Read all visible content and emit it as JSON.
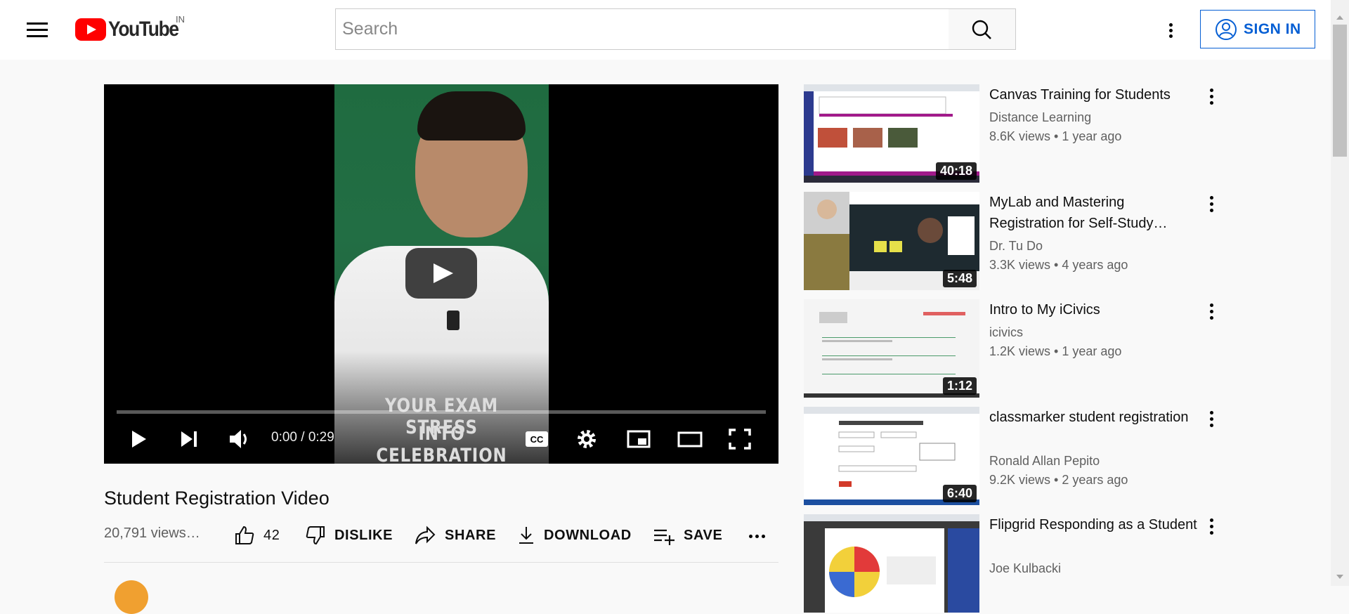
{
  "header": {
    "logo_text": "YouTube",
    "country_code": "IN",
    "search_placeholder": "Search",
    "search_value": "",
    "sign_in_label": "SIGN IN",
    "brand_color": "#ff0000",
    "link_color": "#065fd4"
  },
  "player": {
    "overlay_line1": "YOUR EXAM STRESS",
    "overlay_line2": "INTO CELEBRATION",
    "time_display": "0:00 / 0:29",
    "progress": 0.0,
    "controls": [
      "play-icon",
      "next-icon",
      "volume-icon",
      "captions-icon",
      "settings-icon",
      "miniplayer-icon",
      "theater-icon",
      "fullscreen-icon"
    ]
  },
  "video": {
    "title": "Student Registration Video",
    "views": "20,791 views…",
    "like_count": "42",
    "dislike_label": "DISLIKE",
    "share_label": "SHARE",
    "download_label": "DOWNLOAD",
    "save_label": "SAVE"
  },
  "recommendations": [
    {
      "title": "Canvas Training for Students",
      "channel": "Distance Learning",
      "meta": "8.6K views • 1 year ago",
      "duration": "40:18"
    },
    {
      "title": "MyLab and Mastering Registration for Self-Study…",
      "channel": "Dr. Tu Do",
      "meta": "3.3K views • 4 years ago",
      "duration": "5:48"
    },
    {
      "title": "Intro to My iCivics",
      "channel": "icivics",
      "meta": "1.2K views • 1 year ago",
      "duration": "1:12"
    },
    {
      "title": "classmarker student registration",
      "channel": "Ronald Allan Pepito",
      "meta": "9.2K views • 2 years ago",
      "duration": "6:40"
    },
    {
      "title": "Flipgrid Responding as a Student",
      "channel": "Joe Kulbacki",
      "meta": "",
      "duration": ""
    }
  ]
}
